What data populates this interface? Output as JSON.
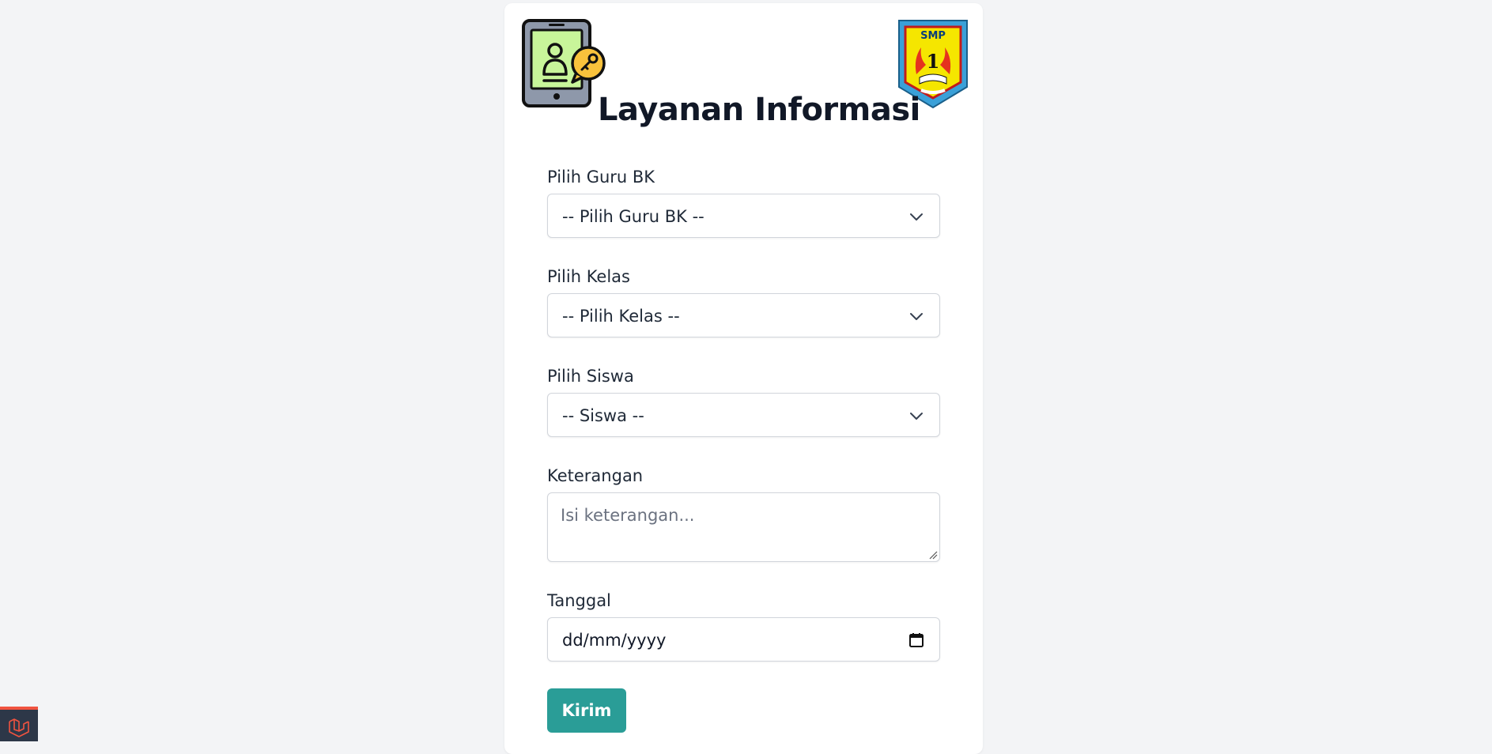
{
  "page": {
    "title": "Layanan Informasi"
  },
  "header": {
    "left_icon": "tablet-user-key-icon",
    "right_logo": "smp-1-school-logo",
    "logo_text": "SMP 1"
  },
  "form": {
    "guru": {
      "label": "Pilih Guru BK",
      "selected": "-- Pilih Guru BK --",
      "icon": "chevron-down-icon"
    },
    "kelas": {
      "label": "Pilih Kelas",
      "selected": "-- Pilih Kelas --",
      "icon": "chevron-down-icon"
    },
    "siswa": {
      "label": "Pilih Siswa",
      "selected": "-- Siswa --",
      "icon": "chevron-down-icon"
    },
    "keterangan": {
      "label": "Keterangan",
      "placeholder": "Isi keterangan..."
    },
    "tanggal": {
      "label": "Tanggal",
      "value": "dd/mm/yyyy",
      "icon": "calendar-icon"
    },
    "submit_label": "Kirim"
  },
  "colors": {
    "background": "#f3f4f6",
    "card": "#ffffff",
    "accent": "#2a9d97",
    "laravel_red": "#f05340"
  }
}
